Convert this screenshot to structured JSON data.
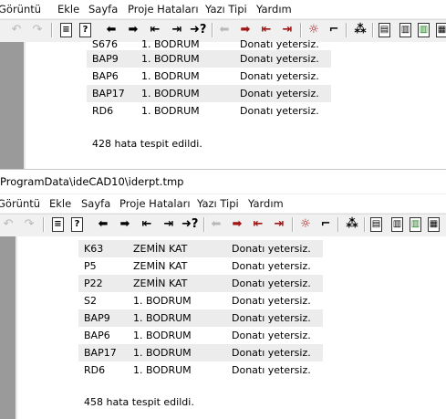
{
  "window1": {
    "menu": [
      "Görüntü",
      "Ekle",
      "Sayfa",
      "Proje Hataları",
      "Yazı Tipi",
      "Yardım"
    ],
    "rows": [
      {
        "id": "S676",
        "floor": "1. BODRUM",
        "message": "Donatı yetersiz.",
        "shaded": false
      },
      {
        "id": "BAP9",
        "floor": "1. BODRUM",
        "message": "Donatı yetersiz.",
        "shaded": true
      },
      {
        "id": "BAP6",
        "floor": "1. BODRUM",
        "message": "Donatı yetersiz.",
        "shaded": false
      },
      {
        "id": "BAP17",
        "floor": "1. BODRUM",
        "message": "Donatı yetersiz.",
        "shaded": true
      },
      {
        "id": "RD6",
        "floor": "1. BODRUM",
        "message": "Donatı yetersiz.",
        "shaded": false
      }
    ],
    "summary": "428 hata tespit edildi."
  },
  "window2": {
    "title": "ProgramData\\ideCAD10\\iderpt.tmp",
    "menu": [
      "Görüntü",
      "Ekle",
      "Sayfa",
      "Proje Hataları",
      "Yazı Tipi",
      "Yardım"
    ],
    "rows": [
      {
        "id": "K63",
        "floor": "ZEMİN KAT",
        "message": "Donatı yetersiz.",
        "shaded": true
      },
      {
        "id": "P5",
        "floor": "ZEMİN KAT",
        "message": "Donatı yetersiz.",
        "shaded": false
      },
      {
        "id": "P22",
        "floor": "ZEMİN KAT",
        "message": "Donatı yetersiz.",
        "shaded": true
      },
      {
        "id": "S2",
        "floor": "1. BODRUM",
        "message": "Donatı yetersiz.",
        "shaded": false
      },
      {
        "id": "BAP9",
        "floor": "1. BODRUM",
        "message": "Donatı yetersiz.",
        "shaded": true
      },
      {
        "id": "BAP6",
        "floor": "1. BODRUM",
        "message": "Donatı yetersiz.",
        "shaded": false
      },
      {
        "id": "BAP17",
        "floor": "1. BODRUM",
        "message": "Donatı yetersiz.",
        "shaded": true
      },
      {
        "id": "RD6",
        "floor": "1. BODRUM",
        "message": "Donatı yetersiz.",
        "shaded": false
      }
    ],
    "summary": "458 hata tespit edildi."
  },
  "toolbar_icons": [
    "undo-icon",
    "redo-icon",
    "page-icon",
    "help-icon",
    "first-icon",
    "next-icon",
    "start-icon",
    "end-icon",
    "goto-icon",
    "prev-error-icon",
    "next-error-icon",
    "first-error-icon",
    "last-error-icon",
    "error-settings-icon",
    "error-sign-icon",
    "format-icon",
    "page-view-icon",
    "two-page-icon",
    "color-page-icon",
    "layout-icon"
  ]
}
